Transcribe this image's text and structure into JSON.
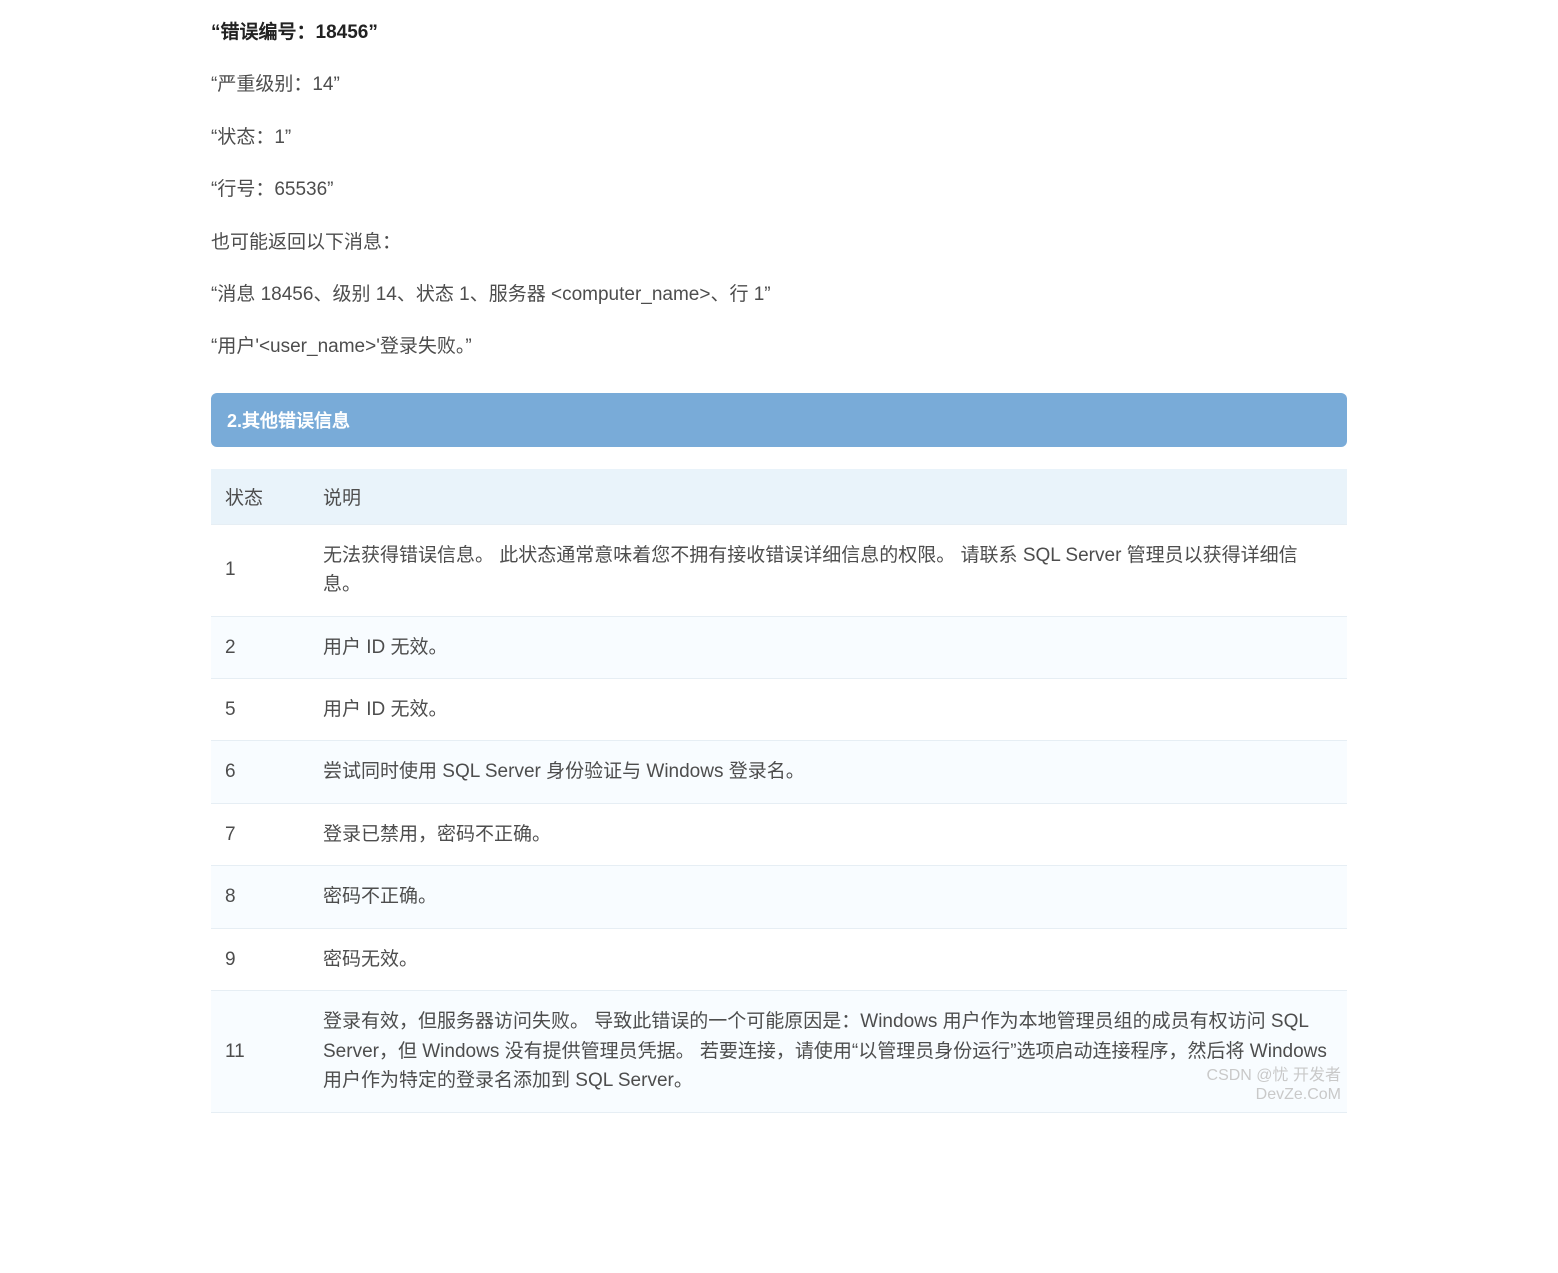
{
  "error_lines": {
    "title": "“错误编号：18456”",
    "severity": "“严重级别：14”",
    "state": "“状态：1”",
    "row": "“行号：65536”",
    "also_label": "也可能返回以下消息：",
    "msg1": "“消息 18456、级别 14、状态 1、服务器 <computer_name>、行 1”",
    "msg2": "“用户'<user_name>'登录失败。”"
  },
  "section2": {
    "title": "2.其他错误信息"
  },
  "table": {
    "headers": {
      "state": "状态",
      "desc": "说明"
    },
    "rows": [
      {
        "state": "1",
        "desc": "无法获得错误信息。 此状态通常意味着您不拥有接收错误详细信息的权限。 请联系 SQL Server 管理员以获得详细信息。"
      },
      {
        "state": "2",
        "desc": "用户 ID 无效。"
      },
      {
        "state": "5",
        "desc": "用户 ID 无效。"
      },
      {
        "state": "6",
        "desc": "尝试同时使用 SQL Server 身份验证与 Windows 登录名。"
      },
      {
        "state": "7",
        "desc": "登录已禁用，密码不正确。"
      },
      {
        "state": "8",
        "desc": "密码不正确。"
      },
      {
        "state": "9",
        "desc": "密码无效。"
      },
      {
        "state": "11",
        "desc": "登录有效，但服务器访问失败。 导致此错误的一个可能原因是：Windows 用户作为本地管理员组的成员有权访问 SQL Server，但 Windows 没有提供管理员凭据。 若要连接，请使用“以管理员身份运行”选项启动连接程序，然后将 Windows 用户作为特定的登录名添加到 SQL Server。"
      }
    ]
  },
  "watermark": {
    "line1": "CSDN @忧 开发者",
    "line2": "DevZe.CoM"
  }
}
